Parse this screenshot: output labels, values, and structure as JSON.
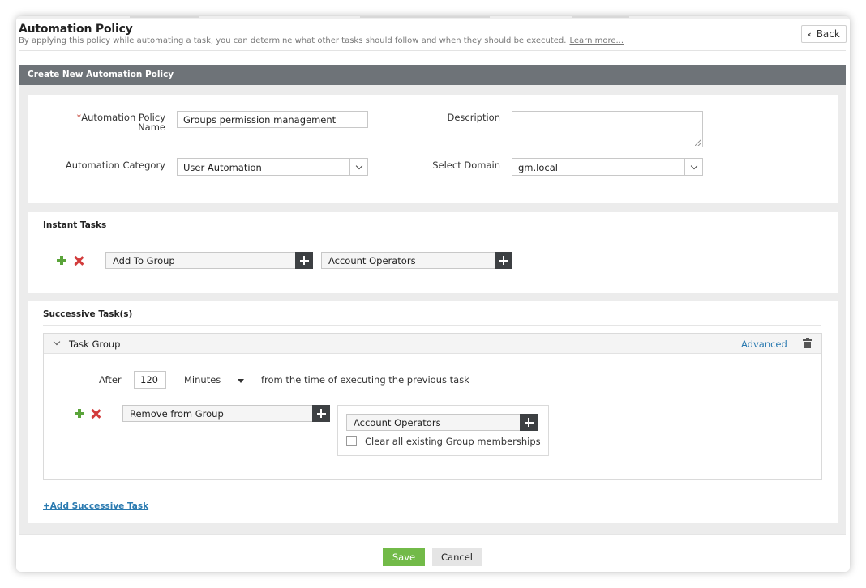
{
  "header": {
    "title": "Automation Policy",
    "subtitle": "By applying this policy while automating a task, you can determine what other tasks should follow and when they should be executed.",
    "learn_more": "Learn more...",
    "back_label": "Back"
  },
  "form": {
    "section_title": "Create New Automation Policy",
    "required_mark": "*",
    "policy_name_label_1": "Automation Policy",
    "policy_name_label_2": "Name",
    "policy_name_value": "Groups permission management",
    "description_label": "Description",
    "description_value": "",
    "category_label": "Automation Category",
    "category_value": "User Automation",
    "domain_label": "Select Domain",
    "domain_value": "gm.local"
  },
  "instant_tasks": {
    "title": "Instant Tasks",
    "task": "Add To Group",
    "target": "Account Operators"
  },
  "successive_tasks": {
    "title": "Successive Task(s)",
    "group_title": "Task Group",
    "advanced_label": "Advanced",
    "after_label": "After",
    "after_value": "120",
    "unit_value": "Minutes",
    "after_suffix": "from the time of executing the previous task",
    "task": "Remove from Group",
    "target": "Account Operators",
    "clear_label": "Clear all existing Group memberships",
    "clear_checked": false,
    "add_link": "+Add Successive Task"
  },
  "footer": {
    "save_label": "Save",
    "cancel_label": "Cancel"
  },
  "colors": {
    "section_bar": "#6e7378",
    "accent_link": "#2a7ab0",
    "save_button": "#72ba48",
    "add_icon": "#5aa43a",
    "remove_icon": "#d23b3b"
  }
}
